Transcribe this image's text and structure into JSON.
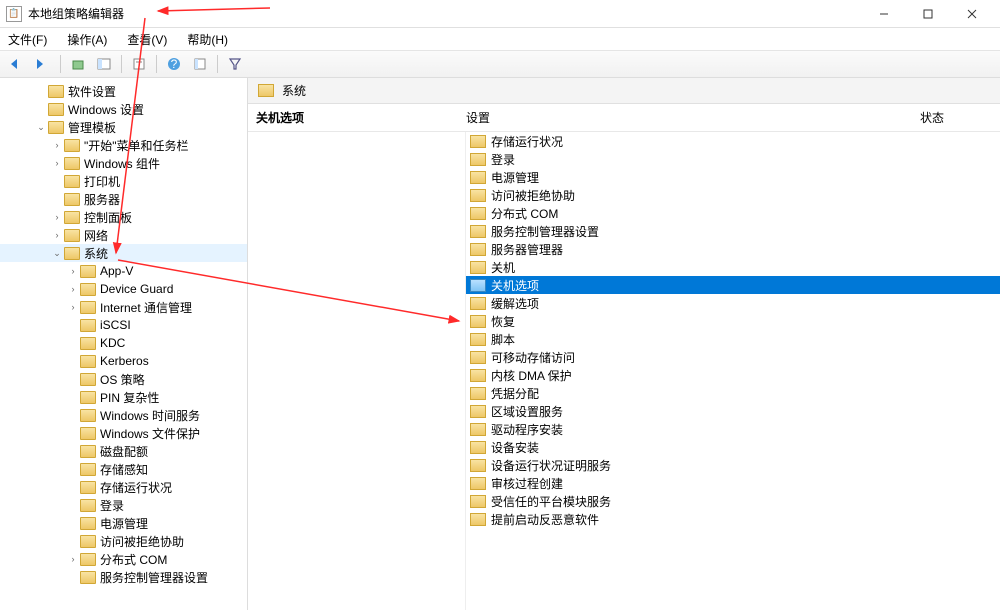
{
  "title": "本地组策略编辑器",
  "menus": [
    "文件(F)",
    "操作(A)",
    "查看(V)",
    "帮助(H)"
  ],
  "path_label": "系统",
  "header": {
    "desc": "关机选项",
    "setting": "设置",
    "state": "状态"
  },
  "tree": [
    {
      "d": 1,
      "e": "",
      "l": "软件设置"
    },
    {
      "d": 1,
      "e": "",
      "l": "Windows 设置"
    },
    {
      "d": 1,
      "e": "v",
      "l": "管理模板"
    },
    {
      "d": 2,
      "e": ">",
      "l": "\"开始\"菜单和任务栏"
    },
    {
      "d": 2,
      "e": ">",
      "l": "Windows 组件"
    },
    {
      "d": 2,
      "e": "",
      "l": "打印机"
    },
    {
      "d": 2,
      "e": "",
      "l": "服务器"
    },
    {
      "d": 2,
      "e": ">",
      "l": "控制面板"
    },
    {
      "d": 2,
      "e": ">",
      "l": "网络"
    },
    {
      "d": 2,
      "e": "v",
      "l": "系统",
      "sel": true
    },
    {
      "d": 3,
      "e": ">",
      "l": "App-V"
    },
    {
      "d": 3,
      "e": ">",
      "l": "Device Guard"
    },
    {
      "d": 3,
      "e": ">",
      "l": "Internet 通信管理"
    },
    {
      "d": 3,
      "e": "",
      "l": "iSCSI"
    },
    {
      "d": 3,
      "e": "",
      "l": "KDC"
    },
    {
      "d": 3,
      "e": "",
      "l": "Kerberos"
    },
    {
      "d": 3,
      "e": "",
      "l": "OS 策略"
    },
    {
      "d": 3,
      "e": "",
      "l": "PIN 复杂性"
    },
    {
      "d": 3,
      "e": "",
      "l": "Windows 时间服务"
    },
    {
      "d": 3,
      "e": "",
      "l": "Windows 文件保护"
    },
    {
      "d": 3,
      "e": "",
      "l": "磁盘配额"
    },
    {
      "d": 3,
      "e": "",
      "l": "存储感知"
    },
    {
      "d": 3,
      "e": "",
      "l": "存储运行状况"
    },
    {
      "d": 3,
      "e": "",
      "l": "登录"
    },
    {
      "d": 3,
      "e": "",
      "l": "电源管理"
    },
    {
      "d": 3,
      "e": "",
      "l": "访问被拒绝协助"
    },
    {
      "d": 3,
      "e": ">",
      "l": "分布式 COM"
    },
    {
      "d": 3,
      "e": "",
      "l": "服务控制管理器设置"
    }
  ],
  "list": [
    "存储运行状况",
    "登录",
    "电源管理",
    "访问被拒绝协助",
    "分布式 COM",
    "服务控制管理器设置",
    "服务器管理器",
    "关机",
    "关机选项",
    "缓解选项",
    "恢复",
    "脚本",
    "可移动存储访问",
    "内核 DMA 保护",
    "凭据分配",
    "区域设置服务",
    "驱动程序安装",
    "设备安装",
    "设备运行状况证明服务",
    "审核过程创建",
    "受信任的平台模块服务",
    "提前启动反恶意软件"
  ],
  "selected_index": 8
}
